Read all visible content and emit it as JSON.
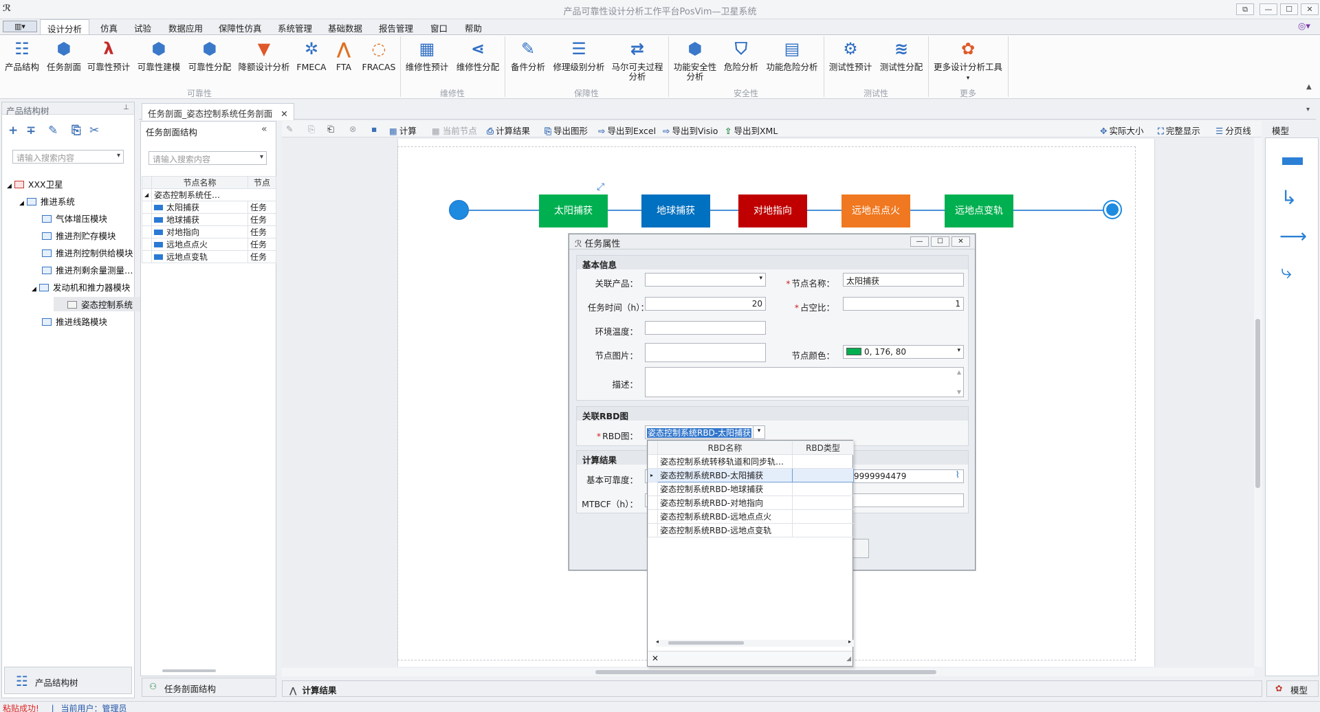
{
  "window": {
    "title": "产品可靠性设计分析工作平台PosVim—卫星系统"
  },
  "menu": {
    "items": [
      "设计分析",
      "仿真",
      "试验",
      "数据应用",
      "保障性仿真",
      "系统管理",
      "基础数据",
      "报告管理",
      "窗口",
      "帮助"
    ]
  },
  "ribbon": {
    "reliability": {
      "label": "可靠性",
      "buttons": [
        "产品结构",
        "任务剖面",
        "可靠性预计",
        "可靠性建模",
        "可靠性分配",
        "降额设计分析",
        "FMECA",
        "FTA",
        "FRACAS"
      ]
    },
    "maintainability": {
      "label": "维修性",
      "buttons": [
        "维修性预计",
        "维修性分配"
      ]
    },
    "supportability": {
      "label": "保障性",
      "buttons": [
        "备件分析",
        "修理级别分析",
        "马尔可夫过程",
        "分析"
      ]
    },
    "safety": {
      "label": "安全性",
      "buttons": [
        "功能安全性",
        "分析",
        "危险分析",
        "功能危险分析"
      ]
    },
    "testability": {
      "label": "测试性",
      "buttons": [
        "测试性预计",
        "测试性分配"
      ]
    },
    "more": {
      "label": "更多",
      "buttons": [
        "更多设计分析工具"
      ]
    }
  },
  "left_panel": {
    "title": "产品结构树",
    "search_placeholder": "请输入搜索内容",
    "tree": [
      "XXX卫星",
      "推进系统",
      "气体增压模块",
      "推进剂贮存模块",
      "推进剂控制供给模块",
      "推进剂剩余量测量…",
      "发动机和推力器模块",
      "姿态控制系统",
      "推进线路模块"
    ],
    "bottom_tab": "产品结构树"
  },
  "doc_tab": {
    "label": "任务剖面_姿态控制系统任务剖面"
  },
  "structure_panel": {
    "title": "任务剖面结构",
    "search_placeholder": "请输入搜索内容",
    "col_name": "节点名称",
    "col_type": "节点",
    "root": "姿态控制系统任…",
    "rows": [
      {
        "name": "太阳捕获",
        "type": "任务"
      },
      {
        "name": "地球捕获",
        "type": "任务"
      },
      {
        "name": "对地指向",
        "type": "任务"
      },
      {
        "name": "远地点点火",
        "type": "任务"
      },
      {
        "name": "远地点变轨",
        "type": "任务"
      }
    ],
    "bottom_tab": "任务剖面结构"
  },
  "canvas_toolbar": {
    "calc": "计算",
    "current_node": "当前节点",
    "calc_result": "计算结果",
    "export_image": "导出图形",
    "export_excel": "导出到Excel",
    "export_visio": "导出到Visio",
    "export_xml": "导出到XML",
    "actual_size": "实际大小",
    "full_view": "完整显示",
    "page_line": "分页线",
    "model": "模型"
  },
  "flow": {
    "nodes": [
      {
        "label": "太阳捕获",
        "color": "#00b050"
      },
      {
        "label": "地球捕获",
        "color": "#0070c0"
      },
      {
        "label": "对地指向",
        "color": "#c00000"
      },
      {
        "label": "远地点点火",
        "color": "#f07820"
      },
      {
        "label": "远地点变轨",
        "color": "#00b050"
      }
    ]
  },
  "dialog": {
    "title": "任务属性",
    "basic_section": "基本信息",
    "related_product_label": "关联产品：",
    "node_name_label": "节点名称：",
    "node_name_value": "太阳捕获",
    "task_time_label": "任务时间（h）：",
    "task_time_value": "20",
    "duty_ratio_label": "占空比：",
    "duty_ratio_value": "1",
    "env_temp_label": "环境温度：",
    "node_image_label": "节点图片：",
    "node_color_label": "节点颜色：",
    "node_color_value": "0, 176, 80",
    "desc_label": "描述：",
    "rbd_section": "关联RBD图",
    "rbd_label": "RBD图：",
    "rbd_value": "姿态控制系统RBD-太阳捕获",
    "calc_section": "计算结果",
    "basic_rel_label": "基本可靠度：",
    "basic_rel_value": "9999994479",
    "mtbcf_label": "MTBCF（h）："
  },
  "popup": {
    "col_name": "RBD名称",
    "col_type": "RBD类型",
    "rows": [
      "姿态控制系统转移轨道和同步轨…",
      "姿态控制系统RBD-太阳捕获",
      "姿态控制系统RBD-地球捕获",
      "姿态控制系统RBD-对地指向",
      "姿态控制系统RBD-远地点点火",
      "姿态控制系统RBD-远地点变轨"
    ]
  },
  "bottom": {
    "calc_result": "计算结果",
    "model": "模型"
  },
  "status": {
    "message": "粘贴成功!",
    "user_label": "当前用户：",
    "user": "管理员"
  }
}
